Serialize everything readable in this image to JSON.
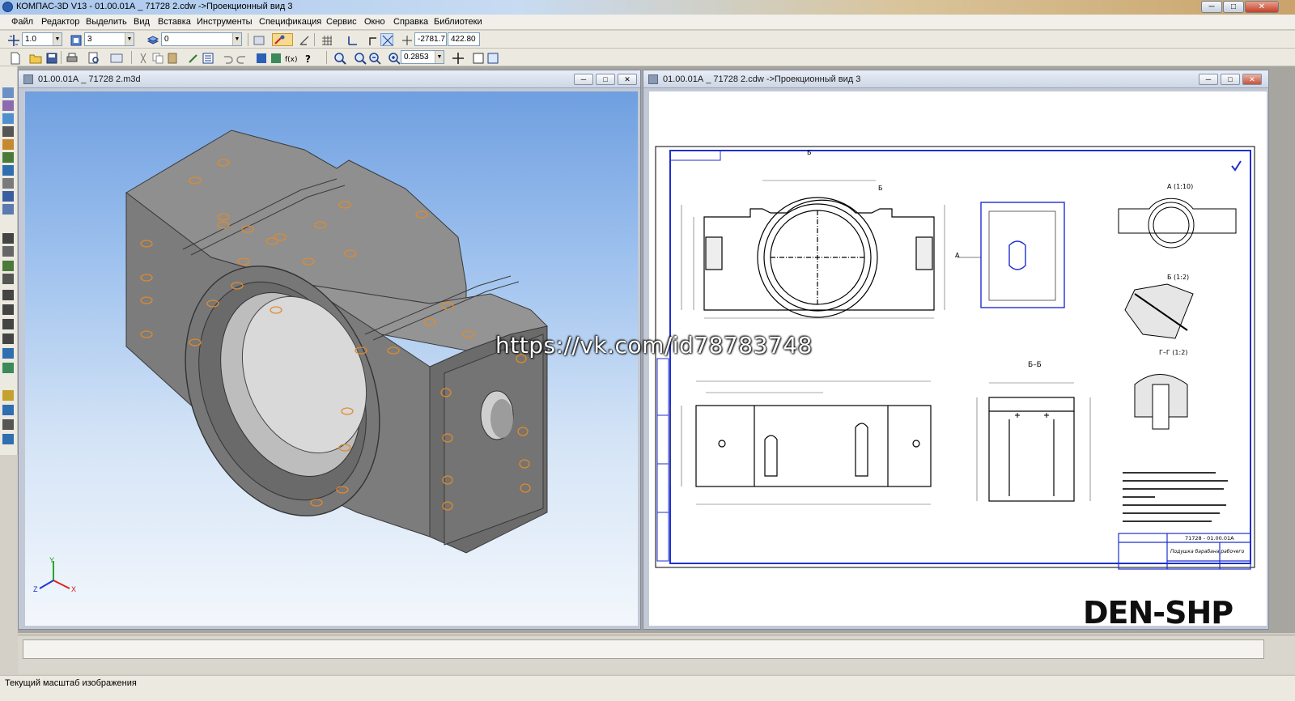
{
  "window": {
    "title": "КОМПАС-3D V13 - 01.00.01А _ 71728 2.cdw ->Проекционный вид 3",
    "minimize": "─",
    "maximize": "□",
    "close": "✕"
  },
  "menu": [
    "Файл",
    "Редактор",
    "Выделить",
    "Вид",
    "Вставка",
    "Инструменты",
    "Спецификация",
    "Сервис",
    "Окно",
    "Справка",
    "Библиотеки"
  ],
  "toolbar1": {
    "step": "1.0",
    "angle_step": "3",
    "layer": "0",
    "coord_x": "-2781.7",
    "coord_y": "422.80"
  },
  "toolbar2": {
    "zoom": "0.2853"
  },
  "doc3d": {
    "title": "01.00.01А _ 71728 2.m3d",
    "axis_x": "X",
    "axis_y": "Y",
    "axis_z": "Z"
  },
  "docdrw": {
    "title": "01.00.01А _ 71728 2.cdw ->Проекционный вид 3",
    "stamp_code": "71728 - 01.00.01А",
    "stamp_name": "Подушка барабана рабочего",
    "section_a": "А (1:10)",
    "section_b": "Б (1:2)",
    "section_g": "Г–Г (1:2)",
    "section_bb": "Б–Б",
    "label_b": "Б",
    "label_a": "А"
  },
  "watermark": "https://vk.com/id78783748",
  "brand": "DEN-SHP",
  "status": {
    "text": "Текущий масштаб изображения"
  },
  "colors": {
    "accent": "#2b5fb8",
    "drawing_frame": "#1f2fd0",
    "model_face": "#8c8c8c"
  }
}
